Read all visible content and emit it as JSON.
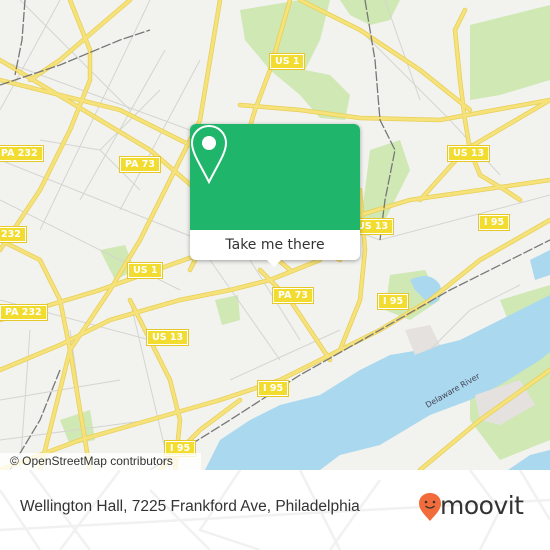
{
  "map": {
    "attribution": "© OpenStreetMap contributors",
    "road_labels": [
      {
        "id": "us1-north",
        "text": "US 1"
      },
      {
        "id": "pa232-north",
        "text": "PA 232"
      },
      {
        "id": "pa73-west",
        "text": "PA 73"
      },
      {
        "id": "us13-east",
        "text": "US 13"
      },
      {
        "id": "us13-mid",
        "text": "US 13"
      },
      {
        "id": "pa232-west",
        "text": "232"
      },
      {
        "id": "us1-south",
        "text": "US 1"
      },
      {
        "id": "pa232-south",
        "text": "PA 232"
      },
      {
        "id": "us13-south",
        "text": "US 13"
      },
      {
        "id": "pa73-south",
        "text": "PA 73"
      },
      {
        "id": "i95-east",
        "text": "I 95"
      },
      {
        "id": "i95-mid",
        "text": "I 95"
      },
      {
        "id": "i95-mid2",
        "text": "I 95"
      },
      {
        "id": "i95-southwest",
        "text": "I 95"
      }
    ],
    "water_label": "Delaware River",
    "colors": {
      "land": "#f2f2ef",
      "road": "#f5e27a",
      "road_casing": "#e8cf55",
      "minor_road": "#d4d4d0",
      "park": "#cfe8b4",
      "water": "#a9d8ef",
      "rail": "#777777"
    }
  },
  "popup": {
    "icon": "map-pin-icon",
    "button_label": "Take me there",
    "color": "#1fb56a"
  },
  "footer": {
    "address": "Wellington Hall, 7225 Frankford Ave, Philadelphia",
    "brand": "moovit",
    "brand_color": "#f26b3a"
  }
}
